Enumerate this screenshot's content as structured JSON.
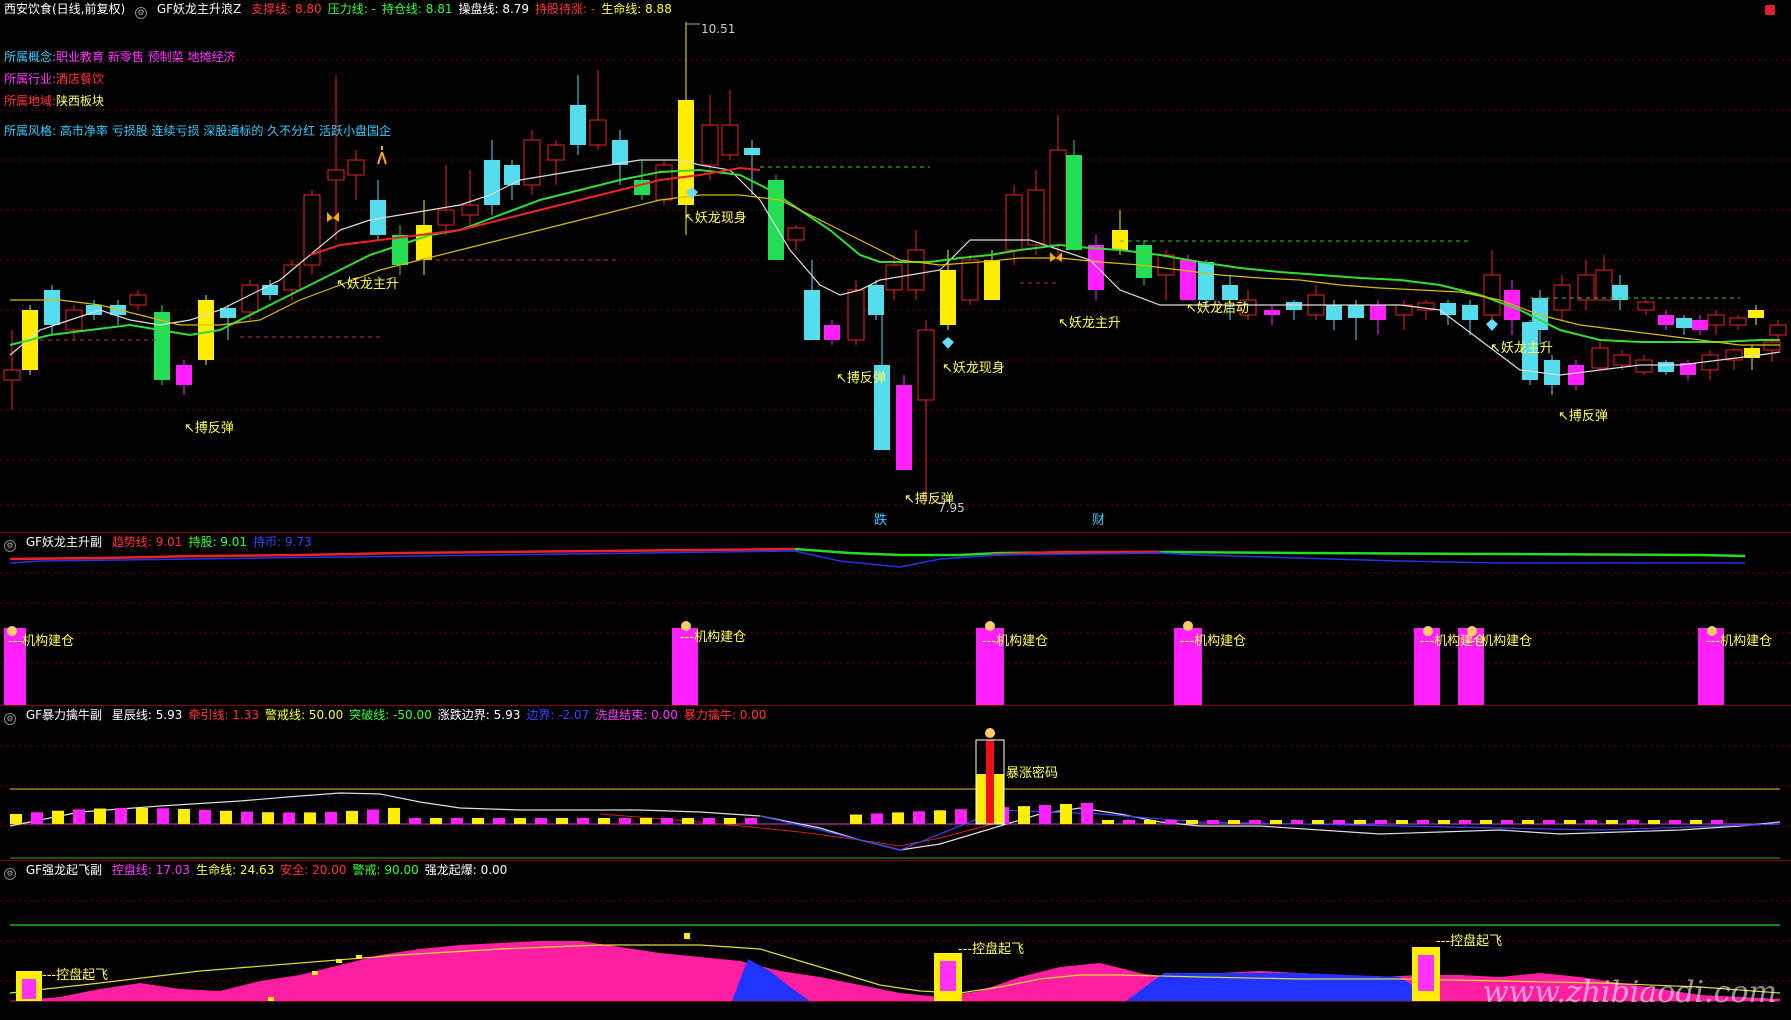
{
  "p1": {
    "name": "西安饮食(日线,前复权)",
    "indicator": "GF妖龙主升浪Z",
    "metrics": [
      {
        "label": "支撑线: 8.80",
        "color": "#ff3333"
      },
      {
        "label": "压力线: -",
        "color": "#33ff33"
      },
      {
        "label": "持仓线: 8.81",
        "color": "#33ff33"
      },
      {
        "label": "操盘线: 8.79",
        "color": "#ffffff"
      },
      {
        "label": "持股待涨: -",
        "color": "#ff3333"
      },
      {
        "label": "生命线: 8.88",
        "color": "#ffff33"
      }
    ],
    "info": [
      {
        "key": "所属概念:",
        "value": "职业教育 新零售 预制菜 地摊经济",
        "kc": "#33ccff",
        "vc": "#ff33ff"
      },
      {
        "key": "所属行业:",
        "value": "酒店餐饮",
        "kc": "#ff33ff",
        "vc": "#ff3333"
      },
      {
        "key": "所属地域:",
        "value": "陕西板块",
        "kc": "#ff3333",
        "vc": "#ffff66"
      }
    ],
    "style_key": "所属风格:",
    "style_value": "高市净率 亏损股 连续亏损 深股通标的 久不分红 活跃小盘国企",
    "high_label": "10.51",
    "low_label": "7.95",
    "ann_fanbounce": "↖搏反弹",
    "ann_yaolong_up": "↖妖龙主升",
    "ann_yaolong_show": "↖妖龙现身",
    "ann_yaolong_start": "↖妖龙启动",
    "ann_yaolong_up2": "↖妖龙主升",
    "ann_die": "跌",
    "ann_cai": "财"
  },
  "p2": {
    "indicator": "GF妖龙主升副",
    "metrics": [
      {
        "label": "趋势线: 9.01",
        "color": "#ff3333"
      },
      {
        "label": "持股: 9.01",
        "color": "#33ff33"
      },
      {
        "label": "持币: 9.73",
        "color": "#3344ff"
      }
    ],
    "build_label": "---机构建仓"
  },
  "p3": {
    "indicator": "GF暴力擒牛副",
    "metrics": [
      {
        "label": "星辰线: 5.93",
        "color": "#ffffff"
      },
      {
        "label": "牵引线: 1.33",
        "color": "#ff3333"
      },
      {
        "label": "警戒线: 50.00",
        "color": "#ffff33"
      },
      {
        "label": "突破线: -50.00",
        "color": "#33ff33"
      },
      {
        "label": "涨跌边界: 5.93",
        "color": "#ffffff"
      },
      {
        "label": "边界: -2.07",
        "color": "#3344ff"
      },
      {
        "label": "洗盘结束: 0.00",
        "color": "#ff33ff"
      },
      {
        "label": "暴力擒牛: 0.00",
        "color": "#ff3333"
      }
    ],
    "surge_label": "暴涨密码"
  },
  "p4": {
    "indicator": "GF强龙起飞副",
    "metrics": [
      {
        "label": "控盘线: 17.03",
        "color": "#ff33ff"
      },
      {
        "label": "生命线: 24.63",
        "color": "#ffff33"
      },
      {
        "label": "安全: 20.00",
        "color": "#ff3333"
      },
      {
        "label": "警戒: 90.00",
        "color": "#33ff33"
      },
      {
        "label": "强龙起爆: 0.00",
        "color": "#ffffff"
      }
    ],
    "fly_label": "---控盘起飞"
  },
  "watermark": "www.zhibiaodi.com"
}
